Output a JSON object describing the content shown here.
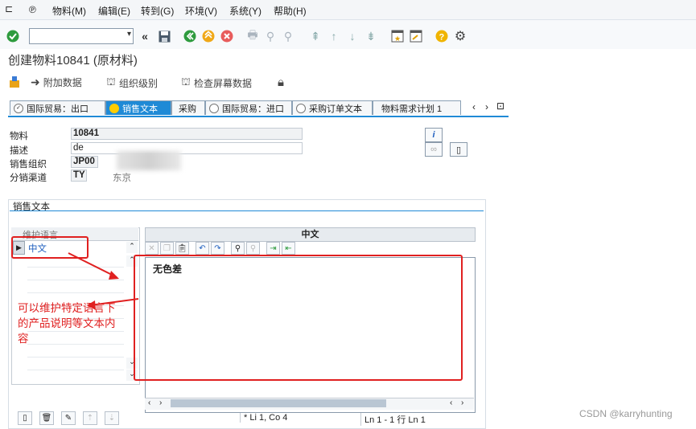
{
  "menu": {
    "items": [
      "物料(M)",
      "编辑(E)",
      "转到(G)",
      "环境(V)",
      "系统(Y)",
      "帮助(H)"
    ]
  },
  "toolbar": {
    "icons": [
      "enter-icon",
      "back-icon",
      "save-icon",
      "nav-back-icon",
      "exit-icon",
      "cancel-icon",
      "print-icon",
      "find-icon",
      "find-next-icon",
      "first-page-icon",
      "prev-page-icon",
      "next-page-icon",
      "last-page-icon",
      "create-session-icon",
      "shortcut-icon",
      "help-icon",
      "settings-icon"
    ]
  },
  "title": "创建物料10841 (原材料)",
  "app_toolbar": {
    "additional_data": "附加数据",
    "org_levels": "组织级别",
    "check_screen_data": "检查屏幕数据"
  },
  "tabs": [
    "国际贸易：出口",
    "销售文本",
    "采购",
    "国际贸易：进口",
    "采购订单文本",
    "物料需求计划 1"
  ],
  "active_tab": "销售文本",
  "header": {
    "material_label": "物料",
    "material_value": "10841",
    "description_label": "描述",
    "description_value": "de",
    "sales_org_label": "销售组织",
    "sales_org_value": "JP00",
    "dist_channel_label": "分销渠道",
    "dist_channel_value": "TY",
    "dist_channel_desc": "东京"
  },
  "section": {
    "title": "销售文本",
    "lang_header": "维护语言",
    "selected_language": "中文",
    "editor_header": "中文",
    "editor_text": "无色差",
    "cursor_position": "* Li 1, Co 4",
    "line_info": "Ln 1 - 1 行 Ln 1"
  },
  "annotation": {
    "text": "可以维护特定语言下的产品说明等文本内容"
  },
  "watermark": "CSDN @karryhunting",
  "colors": {
    "accent": "#1f8ad6",
    "annotation": "#e02020"
  }
}
